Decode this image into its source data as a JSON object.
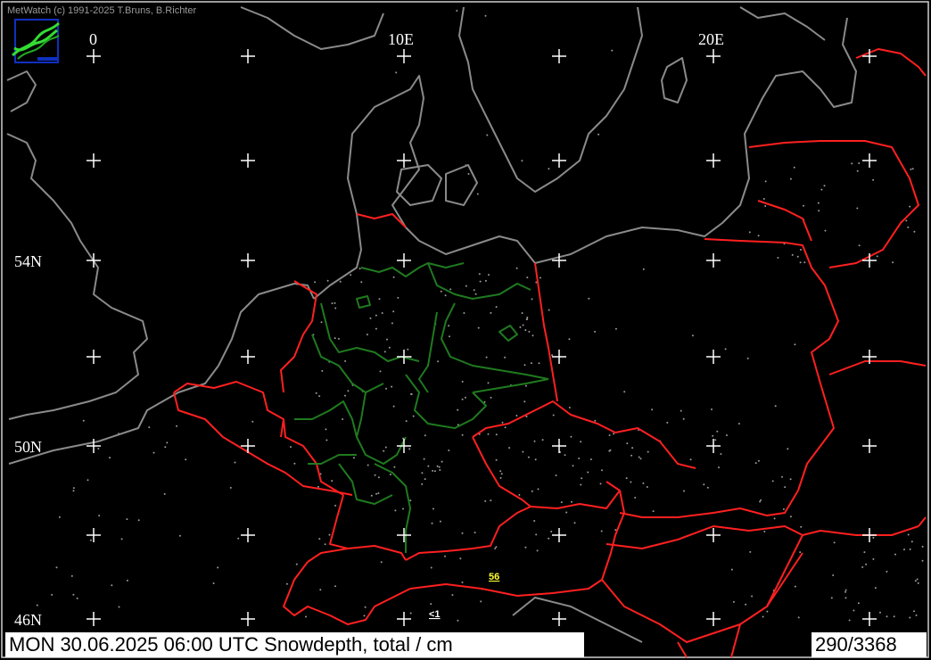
{
  "app": {
    "copyright": "MetWatch  (c) 1991-2025 T.Bruns, B.Richter",
    "logo_icon": "metwatch-logo-icon"
  },
  "map": {
    "lon_labels": [
      "0",
      "10E",
      "20E"
    ],
    "lat_labels": [
      "54N",
      "50N",
      "46N"
    ],
    "values": [
      {
        "text": "56",
        "color": "#ffff33",
        "underlined": true
      },
      {
        "text": "<1",
        "color": "#ffffff",
        "underlined": true
      }
    ],
    "colors": {
      "background": "#000000",
      "coastline": "#8a8a8a",
      "country_border": "#ff2020",
      "state_border": "#1f7a1f",
      "grid": "#ffffff"
    }
  },
  "status": {
    "caption": "MON 30.06.2025 06:00 UTC    Snowdepth, total  / cm",
    "station_count": "290/3368"
  }
}
